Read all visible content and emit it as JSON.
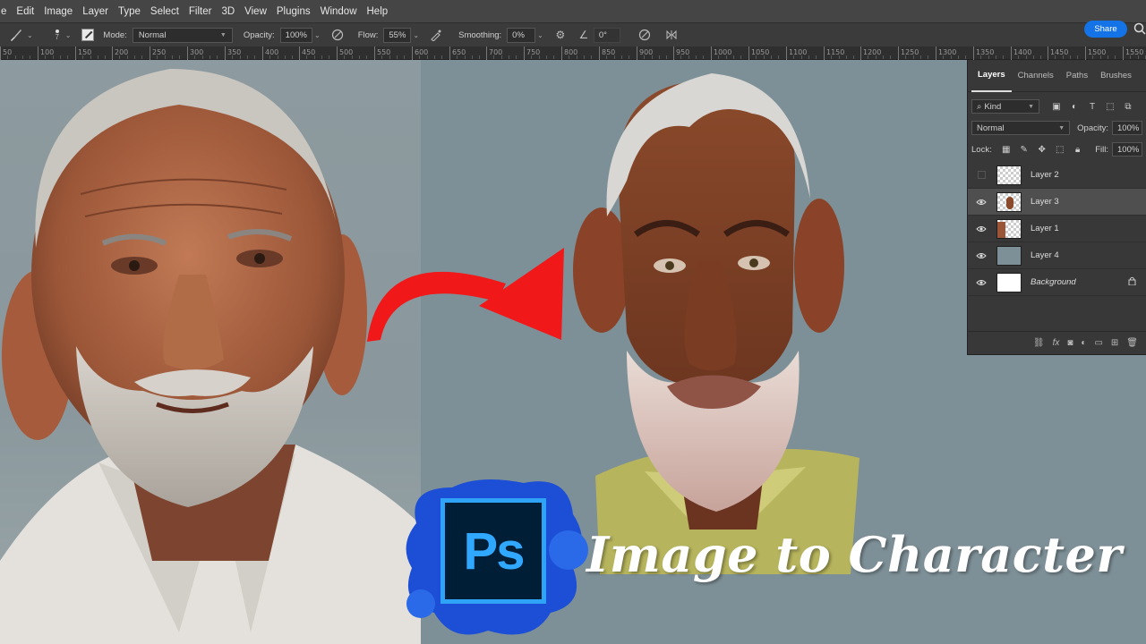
{
  "menu": [
    "e",
    "Edit",
    "Image",
    "Layer",
    "Type",
    "Select",
    "Filter",
    "3D",
    "View",
    "Plugins",
    "Window",
    "Help"
  ],
  "options": {
    "brush_size": "7",
    "mode_label": "Mode:",
    "mode_value": "Normal",
    "opacity_label": "Opacity:",
    "opacity_value": "100%",
    "flow_label": "Flow:",
    "flow_value": "55%",
    "smoothing_label": "Smoothing:",
    "smoothing_value": "0%",
    "angle_value": "0°",
    "share_label": "Share"
  },
  "ruler": [
    "50",
    "100",
    "150",
    "200",
    "250",
    "300",
    "350",
    "400",
    "450",
    "500",
    "550",
    "600",
    "650",
    "700",
    "750",
    "800",
    "850",
    "900",
    "950",
    "1000",
    "1050",
    "1100",
    "1150",
    "1200",
    "1250",
    "1300",
    "1350",
    "1400",
    "1450",
    "1500",
    "1550"
  ],
  "layers_panel": {
    "tabs": [
      "Layers",
      "Channels",
      "Paths",
      "Brushes"
    ],
    "filter_kind": "Kind",
    "blend_mode": "Normal",
    "opacity_label": "Opacity:",
    "opacity_value": "100%",
    "lock_label": "Lock:",
    "fill_label": "Fill:",
    "fill_value": "100%",
    "layers": [
      {
        "name": "Layer 2",
        "visible": false,
        "selected": false,
        "thumb": "transparent"
      },
      {
        "name": "Layer 3",
        "visible": true,
        "selected": true,
        "thumb": "face-cartoon"
      },
      {
        "name": "Layer 1",
        "visible": true,
        "selected": false,
        "thumb": "face-photo"
      },
      {
        "name": "Layer 4",
        "visible": true,
        "selected": false,
        "thumb": "solid-gray"
      },
      {
        "name": "Background",
        "visible": true,
        "selected": false,
        "thumb": "white",
        "locked": true
      }
    ]
  },
  "overlay": {
    "logo_text": "Ps",
    "title": "Image to Character"
  },
  "colors": {
    "accent": "#1473e6",
    "canvas_bg": "#7e9097",
    "arrow": "#f01818",
    "ps_blue": "#31a8ff"
  }
}
